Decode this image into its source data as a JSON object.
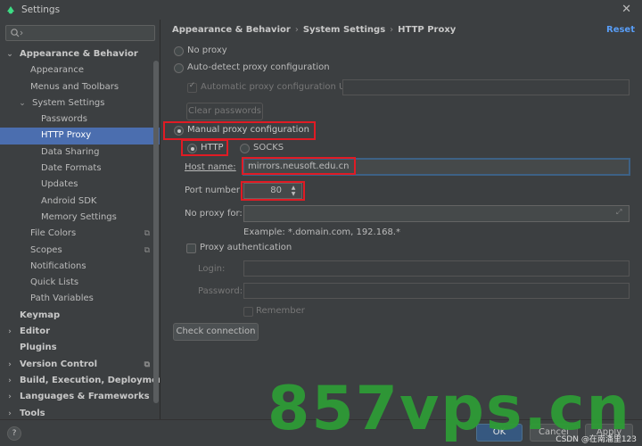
{
  "window": {
    "title": "Settings"
  },
  "sidebar": {
    "search_placeholder": "",
    "items": [
      {
        "label": "Appearance & Behavior",
        "level": 0,
        "bold": true,
        "arrow": "down"
      },
      {
        "label": "Appearance",
        "level": 2
      },
      {
        "label": "Menus and Toolbars",
        "level": 2
      },
      {
        "label": "System Settings",
        "level": 1,
        "arrow": "down"
      },
      {
        "label": "Passwords",
        "level": 3
      },
      {
        "label": "HTTP Proxy",
        "level": 3,
        "selected": true
      },
      {
        "label": "Data Sharing",
        "level": 3
      },
      {
        "label": "Date Formats",
        "level": 3
      },
      {
        "label": "Updates",
        "level": 3
      },
      {
        "label": "Android SDK",
        "level": 3
      },
      {
        "label": "Memory Settings",
        "level": 3
      },
      {
        "label": "File Colors",
        "level": 2,
        "cfg": true
      },
      {
        "label": "Scopes",
        "level": 2,
        "cfg": true
      },
      {
        "label": "Notifications",
        "level": 2
      },
      {
        "label": "Quick Lists",
        "level": 2
      },
      {
        "label": "Path Variables",
        "level": 2
      },
      {
        "label": "Keymap",
        "level": 0,
        "bold": true
      },
      {
        "label": "Editor",
        "level": 0,
        "bold": true,
        "arrow": "right"
      },
      {
        "label": "Plugins",
        "level": 0,
        "bold": true
      },
      {
        "label": "Version Control",
        "level": 0,
        "bold": true,
        "arrow": "right",
        "cfg": true
      },
      {
        "label": "Build, Execution, Deployment",
        "level": 0,
        "bold": true,
        "arrow": "right"
      },
      {
        "label": "Languages & Frameworks",
        "level": 0,
        "bold": true,
        "arrow": "right"
      },
      {
        "label": "Tools",
        "level": 0,
        "bold": true,
        "arrow": "right"
      }
    ]
  },
  "breadcrumb": {
    "part1": "Appearance & Behavior",
    "part2": "System Settings",
    "part3": "HTTP Proxy",
    "separator": "›"
  },
  "reset_label": "Reset",
  "proxy": {
    "no_proxy": "No proxy",
    "auto_detect": "Auto-detect proxy configuration",
    "auto_url_label": "Automatic proxy configuration URL:",
    "auto_url_value": "",
    "clear_passwords": "Clear passwords",
    "manual": "Manual proxy configuration",
    "selected_mode": "manual",
    "http": "HTTP",
    "socks": "SOCKS",
    "selected_protocol": "http",
    "host_label": "Host name:",
    "host_value": "mirrors.neusoft.edu.cn",
    "port_label": "Port number:",
    "port_value": "80",
    "no_proxy_for_label": "No proxy for:",
    "no_proxy_for_value": "",
    "example": "Example: *.domain.com, 192.168.*",
    "auth_label": "Proxy authentication",
    "login_label": "Login:",
    "password_label": "Password:",
    "remember_label": "Remember",
    "check_connection": "Check connection"
  },
  "footer": {
    "help": "?",
    "ok": "OK",
    "cancel": "Cancel",
    "apply": "Apply",
    "note": "CSDN @在南潘里123"
  },
  "watermark": "857vps.cn",
  "colors": {
    "background": "#3c3f41",
    "selection": "#4b6eaf",
    "link": "#589df6",
    "highlight_box": "#e01b24",
    "watermark": "#2e9b36"
  }
}
